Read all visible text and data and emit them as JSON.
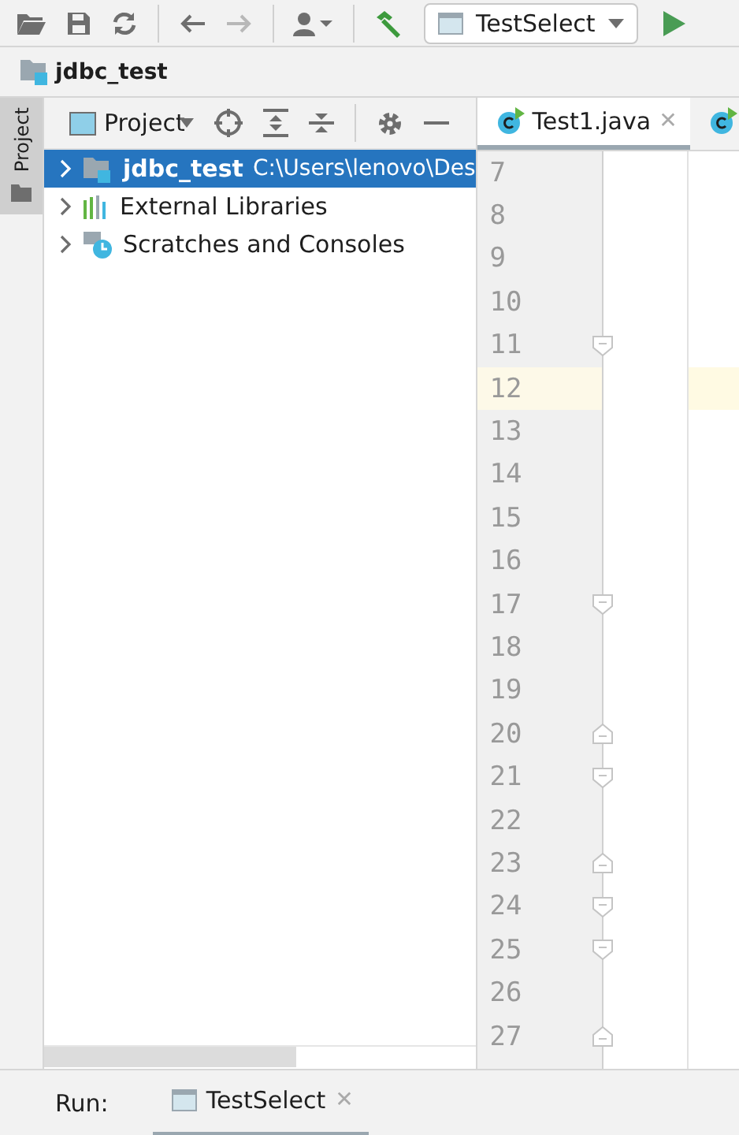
{
  "toolbar": {
    "buttons": [
      {
        "kind": "open",
        "disabled": false
      },
      {
        "kind": "save",
        "disabled": false
      },
      {
        "kind": "sync",
        "disabled": false
      },
      {
        "kind": "back",
        "disabled": false
      },
      {
        "kind": "forward",
        "disabled": true
      },
      {
        "kind": "user",
        "disabled": false
      },
      {
        "kind": "build",
        "disabled": false
      }
    ],
    "run_config": "TestSelect"
  },
  "breadcrumb": {
    "title": "jdbc_test"
  },
  "side_stripe": {
    "label": "Project"
  },
  "project_panel": {
    "title": "Project",
    "items": [
      {
        "kind": "module",
        "name": "jdbc_test",
        "path": "C:\\Users\\lenovo\\Des",
        "selected": true,
        "expanded": false
      },
      {
        "kind": "libraries",
        "name": "External Libraries",
        "selected": false,
        "expanded": false
      },
      {
        "kind": "scratches",
        "name": "Scratches and Consoles",
        "selected": false,
        "expanded": false
      }
    ]
  },
  "editor": {
    "tabs": [
      {
        "label": "Test1.java",
        "close": "✕",
        "selected": true
      },
      {
        "selected": false
      }
    ],
    "lines": [
      {
        "number": "7",
        "kind": "plain",
        "current": false
      },
      {
        "number": "8",
        "kind": "plain",
        "current": false
      },
      {
        "number": "9",
        "kind": "plain",
        "current": false
      },
      {
        "number": "10",
        "kind": "plain",
        "current": false
      },
      {
        "number": "11",
        "kind": "foldstart",
        "current": false
      },
      {
        "number": "12",
        "kind": "plain",
        "current": true
      },
      {
        "number": "13",
        "kind": "plain",
        "current": false
      },
      {
        "number": "14",
        "kind": "plain",
        "current": false
      },
      {
        "number": "15",
        "kind": "plain",
        "current": false
      },
      {
        "number": "16",
        "kind": "plain",
        "current": false
      },
      {
        "number": "17",
        "kind": "foldstart",
        "current": false
      },
      {
        "number": "18",
        "kind": "plain",
        "current": false
      },
      {
        "number": "19",
        "kind": "plain",
        "current": false
      },
      {
        "number": "20",
        "kind": "foldend",
        "current": false
      },
      {
        "number": "21",
        "kind": "foldstart",
        "current": false
      },
      {
        "number": "22",
        "kind": "plain",
        "current": false
      },
      {
        "number": "23",
        "kind": "foldend",
        "current": false
      },
      {
        "number": "24",
        "kind": "foldstart",
        "current": false
      },
      {
        "number": "25",
        "kind": "foldstart",
        "current": false
      },
      {
        "number": "26",
        "kind": "plain",
        "current": false
      },
      {
        "number": "27",
        "kind": "foldend",
        "current": false
      }
    ]
  },
  "run_bar": {
    "label": "Run:",
    "tabs": [
      {
        "label": "TestSelect",
        "close": "✕",
        "selected": true
      }
    ]
  }
}
